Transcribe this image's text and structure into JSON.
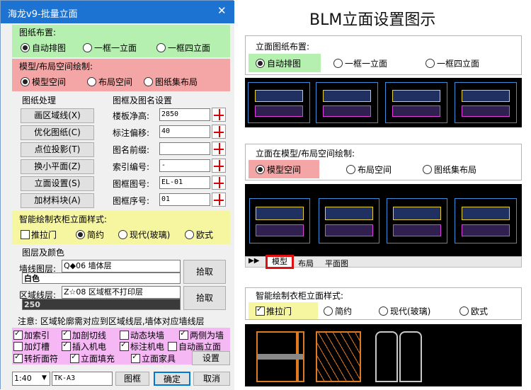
{
  "dialog": {
    "title": "海龙v9-批量立面",
    "close_glyph": "✕"
  },
  "layout_group": {
    "title": "图纸布置:",
    "options": [
      "自动排图",
      "一框一立面",
      "一框四立面"
    ],
    "selected": 0
  },
  "space_group": {
    "title": "模型/布局空间绘制:",
    "options": [
      "模型空间",
      "布局空间",
      "图纸集布局"
    ],
    "selected": 0
  },
  "processing": {
    "title": "图纸处理",
    "buttons": [
      "画区域线(X)",
      "优化图纸(C)",
      "点位投影(T)",
      "换小平面(Z)",
      "立面设置(S)",
      "加材料块(A)"
    ]
  },
  "frame": {
    "title": "图框及图名设置",
    "fields": [
      {
        "label": "楼板净高:",
        "value": "2850"
      },
      {
        "label": "标注偏移:",
        "value": "40"
      },
      {
        "label": "图名前缀:",
        "value": ""
      },
      {
        "label": "索引编号:",
        "value": "-"
      },
      {
        "label": "图框图号:",
        "value": "EL-01"
      },
      {
        "label": "图框序号:",
        "value": "01"
      }
    ]
  },
  "wardrobe": {
    "title": "智能绘制衣柜立面样式:",
    "push_door": "推拉门",
    "options": [
      "简约",
      "现代(玻璃)",
      "欧式"
    ],
    "selected": 0
  },
  "layers": {
    "title": "图层及颜色",
    "wall_label": "墙线图层:",
    "wall_value": "Q◆06 墙体层",
    "wall_color": "白色",
    "region_label": "区域线层:",
    "region_value": "Z☆08 区域框不打印层",
    "region_color": "250",
    "pick": "拾取"
  },
  "note": "注意: 区域轮廓需对应到区域线层,墙体对应墙线层",
  "checks": [
    {
      "label": "加索引",
      "on": true
    },
    {
      "label": "加剖切线",
      "on": true
    },
    {
      "label": "动态块墙",
      "on": false
    },
    {
      "label": "两侧为墙",
      "on": true
    },
    {
      "label": "加灯槽",
      "on": false
    },
    {
      "label": "插入机电",
      "on": true
    },
    {
      "label": "标注机电",
      "on": true
    },
    {
      "label": "自动画立面",
      "on": false
    },
    {
      "label": "转折面符",
      "on": true
    },
    {
      "label": "立面填充",
      "on": true
    },
    {
      "label": "立面家具",
      "on": true
    }
  ],
  "settings_btn": "设置",
  "bottom": {
    "scale": "1:40",
    "frame_name": "TK-A3",
    "frame_btn": "图框",
    "ok": "确定",
    "cancel": "取消"
  },
  "right": {
    "title": "BLM立面设置图示",
    "p1": {
      "title": "立面图纸布置:",
      "options": [
        "自动排图",
        "一框一立面",
        "一框四立面"
      ]
    },
    "p2": {
      "title": "立面在模型/布局空间绘制:",
      "options": [
        "模型空间",
        "布局空间",
        "图纸集布局"
      ]
    },
    "tabs": [
      "模型",
      "布局",
      "平面图"
    ],
    "p3": {
      "title": "智能绘制衣柜立面样式:",
      "options": [
        "推拉门",
        "简约",
        "现代(玻璃)",
        "欧式"
      ]
    }
  },
  "colors": {
    "titlebar": "#1d73d2",
    "green": "#b6f0b0",
    "red": "#f4a6a6",
    "yellow": "#f6f6a0",
    "pink": "#f5b8f5"
  }
}
